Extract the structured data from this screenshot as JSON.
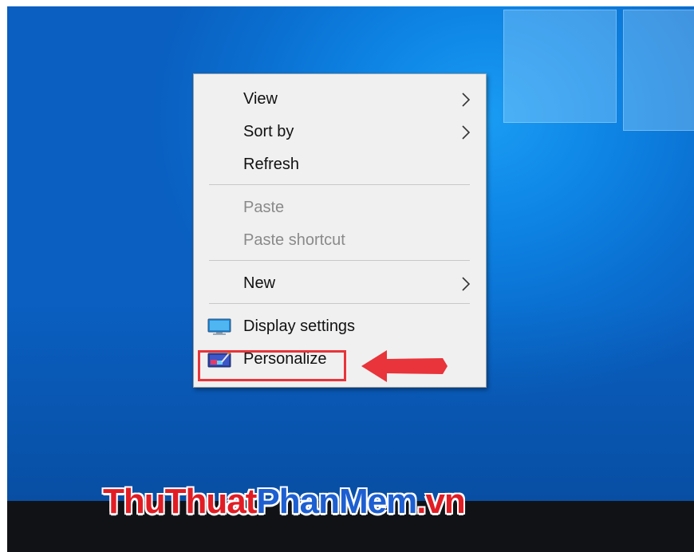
{
  "context_menu": {
    "items": [
      {
        "label": "View",
        "has_submenu": true,
        "enabled": true
      },
      {
        "label": "Sort by",
        "has_submenu": true,
        "enabled": true
      },
      {
        "label": "Refresh",
        "has_submenu": false,
        "enabled": true
      },
      {
        "label": "Paste",
        "has_submenu": false,
        "enabled": false
      },
      {
        "label": "Paste shortcut",
        "has_submenu": false,
        "enabled": false
      },
      {
        "label": "New",
        "has_submenu": true,
        "enabled": true
      },
      {
        "label": "Display settings",
        "has_submenu": false,
        "enabled": true,
        "icon": "display-icon"
      },
      {
        "label": "Personalize",
        "has_submenu": false,
        "enabled": true,
        "icon": "personalize-icon",
        "highlighted": true
      }
    ]
  },
  "watermark": {
    "part1": "ThuThuat",
    "part2": "PhanMem",
    "part3": ".vn"
  },
  "colors": {
    "desktop": "#0e86e6",
    "menu_bg": "#f0f0f0",
    "highlight_red": "#e8343a",
    "taskbar": "#101215",
    "watermark_red": "#e11d24",
    "watermark_blue": "#1d5fd1"
  }
}
